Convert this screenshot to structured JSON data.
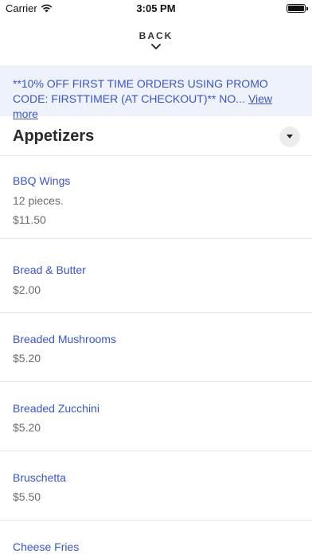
{
  "status_bar": {
    "carrier": "Carrier",
    "time": "3:05 PM"
  },
  "nav": {
    "back_label": "BACK"
  },
  "promo": {
    "text": "**10% OFF FIRST TIME ORDERS USING PROMO CODE: FIRSTTIMER (AT CHECKOUT)** NO...",
    "view_more": "View more"
  },
  "section": {
    "title": "Appetizers"
  },
  "items": [
    {
      "name": "BBQ Wings",
      "description": "12 pieces.",
      "price": "$11.50"
    },
    {
      "name": "Bread & Butter",
      "price": "$2.00"
    },
    {
      "name": "Breaded Mushrooms",
      "price": "$5.20"
    },
    {
      "name": "Breaded Zucchini",
      "price": "$5.20"
    },
    {
      "name": "Bruschetta",
      "price": "$5.50"
    },
    {
      "name": "Cheese Fries"
    }
  ],
  "colors": {
    "accent": "#3b55c9",
    "promo_bg": "#eef2fb",
    "muted_text": "#6b6b6b"
  }
}
